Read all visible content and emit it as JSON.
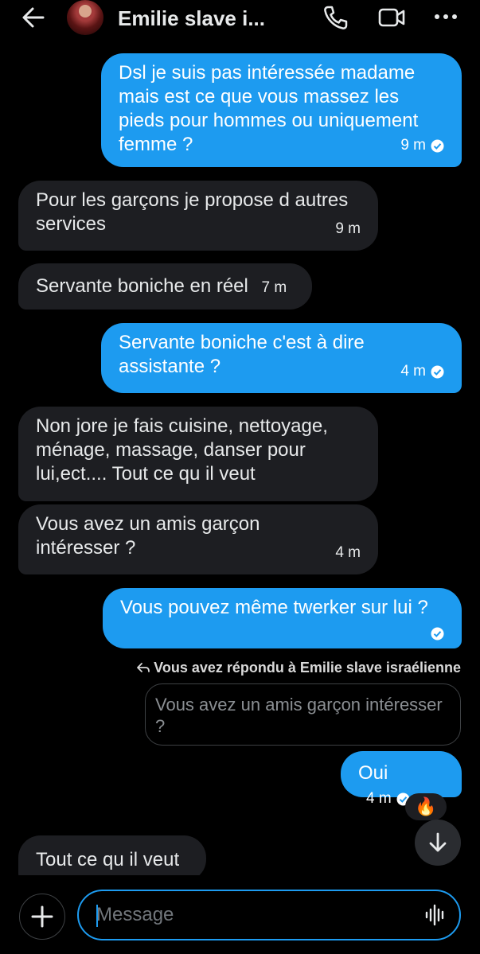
{
  "header": {
    "title": "Emilie slave i..."
  },
  "messages": [
    {
      "id": "m1",
      "direction": "sent",
      "text": "Dsl je suis pas intéressée madame mais est ce que vous massez les pieds pour hommes ou uniquement femme ?",
      "time": "9 m",
      "read": true
    },
    {
      "id": "m2",
      "direction": "received",
      "text": "Pour les garçons je propose d autres services",
      "time": "9 m"
    },
    {
      "id": "m3",
      "direction": "received",
      "text": "Servante boniche en réel",
      "time": "7 m"
    },
    {
      "id": "m4",
      "direction": "sent",
      "text": "Servante boniche c'est à dire assistante ?",
      "time": "4 m",
      "read": true
    },
    {
      "id": "m5",
      "direction": "received",
      "text": "Non jore je fais cuisine, nettoyage, ménage, massage, danser pour lui,ect.... Tout ce qu il veut",
      "time": ""
    },
    {
      "id": "m6",
      "direction": "received",
      "text": "Vous avez un amis garçon intéresser ?",
      "time": "4 m"
    },
    {
      "id": "m7",
      "direction": "sent",
      "text": "Vous pouvez même twerker sur lui ?",
      "time": "",
      "read": true
    },
    {
      "id": "m8",
      "direction": "sent",
      "text": "Oui",
      "time": "4 m",
      "read": true,
      "reaction": "🔥"
    },
    {
      "id": "m9",
      "direction": "received",
      "text": "Tout ce qu il veut",
      "time": ""
    }
  ],
  "reply": {
    "note": "Vous avez répondu à Emilie slave israélienne",
    "quoted": "Vous avez un amis garçon intéresser ?"
  },
  "composer": {
    "placeholder": "Message"
  },
  "colors": {
    "accent": "#1d9bf0",
    "received_bubble": "#1d1e22",
    "background": "#000000"
  },
  "icons": [
    "back-arrow-icon",
    "phone-icon",
    "video-icon",
    "more-icon",
    "read-check-icon",
    "reply-arrow-icon",
    "arrow-down-icon",
    "plus-icon",
    "voice-wave-icon"
  ]
}
